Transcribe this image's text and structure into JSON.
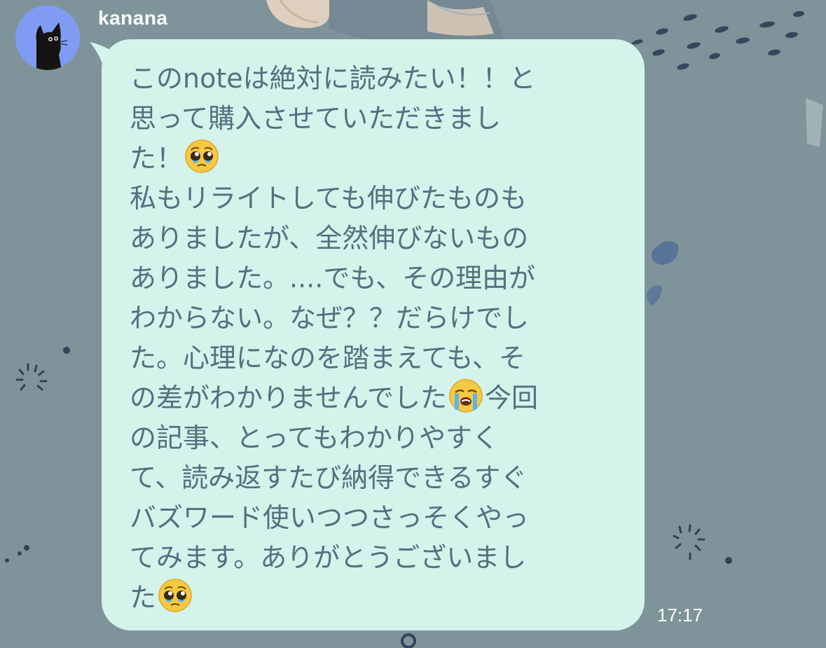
{
  "chat": {
    "sender_name": "kanana",
    "time": "17:17",
    "message_lines": [
      "このnoteは絶対に読みたい！！と",
      "思って購入させていただきまし",
      "た！",
      "私もリライトしても伸びたものも",
      "ありましたが、全然伸びないもの",
      "ありました。....でも、その理由が",
      "わからない。なぜ？？だらけでし",
      "た。心理になのを踏まえても、そ",
      "の差がわかりませんでした",
      "今回",
      "の記事、とってもわかりやすく",
      "て、読み返すたび納得できるすぐ",
      "バズワード使いつつさっそくやっ",
      "てみます。ありがとうございまし",
      "た"
    ]
  },
  "icons": {
    "avatar": "black-cat-avatar",
    "emoji_1": "pleading-face-emoji",
    "emoji_2": "loudly-crying-face-emoji",
    "emoji_3": "pleading-face-emoji"
  },
  "colors": {
    "background": "#7f949a",
    "bubble": "#d4f3ea",
    "message_text": "#566f80",
    "avatar_bg": "#7f9cf2"
  }
}
